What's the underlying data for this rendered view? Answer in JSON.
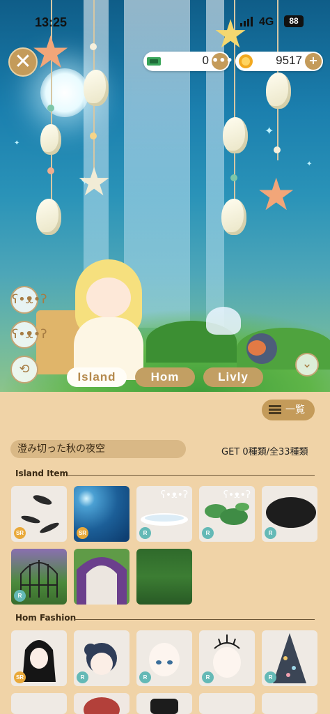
{
  "status_bar": {
    "time": "13:25",
    "network": "4G",
    "battery": "88"
  },
  "currency": {
    "tickets": {
      "icon": "ticket-icon",
      "value": "0",
      "button": "•••"
    },
    "coins": {
      "icon": "coin-icon",
      "value": "9517",
      "button": "+"
    }
  },
  "scene_buttons": {
    "close": "✕"
  },
  "tabs": [
    {
      "label": "Island",
      "active": true
    },
    {
      "label": "Hom",
      "active": false
    },
    {
      "label": "Livly",
      "active": false
    }
  ],
  "list_button": {
    "label": "一覧"
  },
  "collection": {
    "name": "澄み切った秋の夜空",
    "count": "GET 0種類/全33種類"
  },
  "sections": {
    "island": {
      "title": "Island Item",
      "items": [
        {
          "name": "black-feathers",
          "rarity": "SR",
          "badge": false
        },
        {
          "name": "starry-night-sky",
          "rarity": "SR",
          "badge": false
        },
        {
          "name": "white-flowers",
          "rarity": "R",
          "badge": true
        },
        {
          "name": "lily-pads",
          "rarity": "R",
          "badge": true
        },
        {
          "name": "black-fluff",
          "rarity": "R",
          "badge": false
        },
        {
          "name": "vine-cage",
          "rarity": "R",
          "badge": false
        },
        {
          "name": "grape-arch",
          "rarity": "",
          "badge": false
        },
        {
          "name": "hedge-backdrop",
          "rarity": "",
          "badge": false
        }
      ]
    },
    "hom": {
      "title": "Hom Fashion",
      "items": [
        {
          "name": "black-long-hair",
          "rarity": "SR"
        },
        {
          "name": "navy-bun-hair",
          "rarity": "R"
        },
        {
          "name": "face-makeup",
          "rarity": "R"
        },
        {
          "name": "thorn-halo",
          "rarity": "R"
        },
        {
          "name": "floral-cape",
          "rarity": "R"
        }
      ]
    }
  },
  "colors": {
    "panel_bg": "#f0d3a7",
    "accent_gold": "#c49b5a",
    "rarity_sr": "#e9a93a",
    "rarity_r": "#64b9b6"
  }
}
